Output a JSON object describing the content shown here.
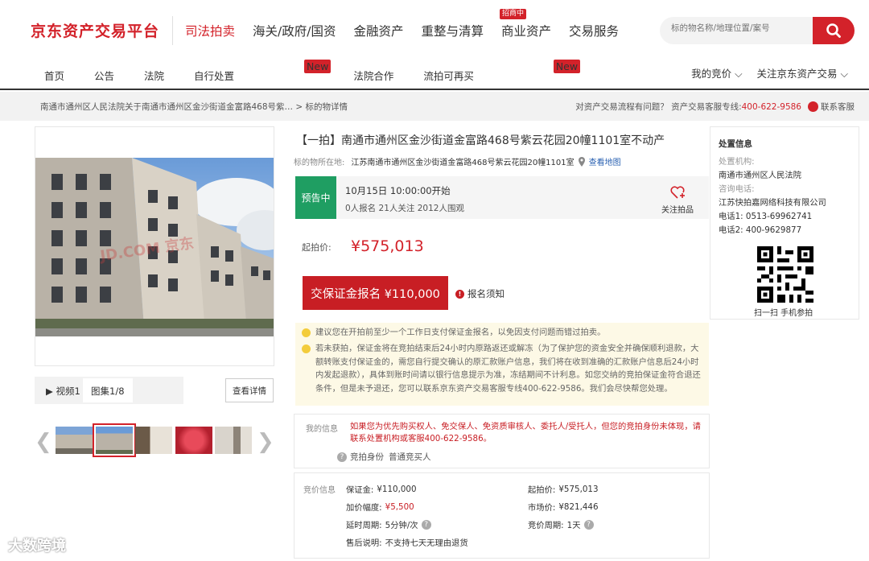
{
  "header": {
    "logo": "京东资产交易平台",
    "nav": [
      {
        "label": "司法拍卖",
        "active": true
      },
      {
        "label": "海关/政府/国资"
      },
      {
        "label": "金融资产"
      },
      {
        "label": "重整与清算"
      },
      {
        "label": "商业资产",
        "badge": "招商中"
      },
      {
        "label": "交易服务"
      }
    ],
    "search_placeholder": "标的物名称/地理位置/案号"
  },
  "subnav": {
    "items": [
      {
        "label": "首页"
      },
      {
        "label": "公告"
      },
      {
        "label": "法院"
      },
      {
        "label": "自行处置",
        "badge": "New"
      },
      {
        "label": "法院合作"
      },
      {
        "label": "流拍可再买",
        "badge": "New"
      }
    ],
    "my_bids": "我的竞价 ⌵",
    "follow": "关注京东资产交易 ⌵"
  },
  "breadcrumb": {
    "path": "南通市通州区人民法院关于南通市通州区金沙街道金富路468号紫… > 标的物详情",
    "help": "对资产交易流程有问题？ 资产交易客服专线:",
    "phone": "400-622-9586",
    "service": "联系客服"
  },
  "gallery": {
    "watermark": "JD.COM 京东",
    "video_tab": "▶ 视频1",
    "image_tab": "图集1/8",
    "detail_button": "查看详情"
  },
  "item": {
    "title": "【一拍】南通市通州区金沙街道金富路468号紫云花园20幢1101室不动产",
    "location_label": "标的物所在地:",
    "location": "江苏南通市通州区金沙街道金富路468号紫云花园20幢1101室",
    "map_link": "查看地图",
    "status": "预告中",
    "start_time": "10月15日 10:00:00开始",
    "stats": "0人报名  21人关注  2012人围观",
    "follow_label": "关注拍品",
    "start_price_label": "起拍价:",
    "start_price": "¥575,013",
    "deposit_button": "交保证金报名 ¥110,000",
    "notice_link": "报名须知",
    "tips": [
      "建议您在开拍前至少一个工作日支付保证金报名，以免因支付问题而错过拍卖。",
      "若未获拍，保证金将在竞拍结束后24小时内原路返还或解冻（为了保护您的资金安全并确保顺利退款，大额转账支付保证金的，需您自行提交确认的原汇款账户信息，我们将在收到准确的汇款账户信息后24小时内发起退款），具体到账时间请以银行信息提示为准，冻结期间不计利息。如您交纳的竞拍保证金符合退还条件，但是未予退还，您可以联系京东资产交易客服专线400-622-9586。我们会尽快帮您处理。"
    ]
  },
  "my_info": {
    "label": "我的信息",
    "warning": "如果您为优先购买权人、免交保人、免资质审核人、委托人/受托人，但您的竞拍身份未体现，请联系处置机构或客服400-622-9586。",
    "identity_label": "竞拍身份",
    "identity_value": "普通竞买人"
  },
  "price_info": {
    "label": "竞价信息",
    "deposit": {
      "k": "保证金:",
      "v": "¥110,000"
    },
    "start": {
      "k": "起拍价:",
      "v": "¥575,013"
    },
    "increment": {
      "k": "加价幅度:",
      "v": "¥5,500"
    },
    "market": {
      "k": "市场价:",
      "v": "¥821,446"
    },
    "delay": {
      "k": "延时周期:",
      "v": "5分钟/次"
    },
    "cycle": {
      "k": "竞价周期:",
      "v": "1天"
    },
    "after_sale": {
      "k": "售后说明:",
      "v": "不支持七天无理由退货"
    }
  },
  "side": {
    "title": "处置信息",
    "org_label": "处置机构:",
    "org": "南通市通州区人民法院",
    "consult_label": "咨询电话:",
    "consult": "江苏快拍嘉网络科技有限公司",
    "phone1": "电话1: 0513-69962741",
    "phone2": "电话2: 400-9629877",
    "qr_caption": "扫一扫 手机参拍"
  },
  "watermark": "大数跨境",
  "colors": {
    "brand": "#d3222a",
    "status_green": "#1f9e62",
    "tip_bg": "#fdf9e6"
  }
}
